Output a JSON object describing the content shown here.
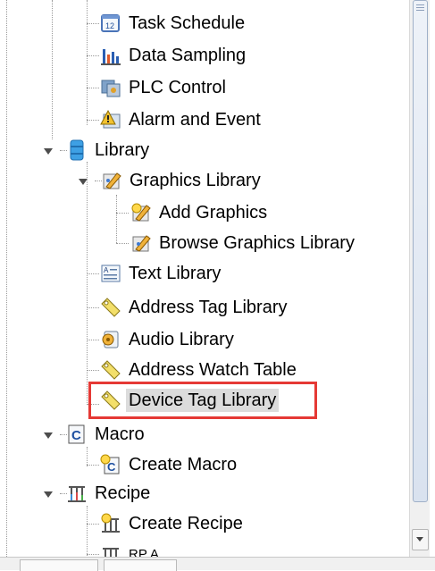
{
  "tree": {
    "items": [
      {
        "label": "Task Schedule",
        "icon": "task-schedule-icon"
      },
      {
        "label": "Data Sampling",
        "icon": "data-sampling-icon"
      },
      {
        "label": "PLC Control",
        "icon": "plc-control-icon"
      },
      {
        "label": "Alarm and Event",
        "icon": "alarm-event-icon"
      },
      {
        "label": "Library",
        "icon": "library-icon",
        "expanded": true
      },
      {
        "label": "Graphics Library",
        "icon": "graphics-library-icon",
        "expanded": true
      },
      {
        "label": "Add Graphics",
        "icon": "add-graphics-icon"
      },
      {
        "label": "Browse Graphics Library",
        "icon": "browse-graphics-icon"
      },
      {
        "label": "Text Library",
        "icon": "text-library-icon"
      },
      {
        "label": "Address Tag Library",
        "icon": "tag-icon"
      },
      {
        "label": "Audio Library",
        "icon": "audio-library-icon"
      },
      {
        "label": "Address Watch Table",
        "icon": "tag-icon"
      },
      {
        "label": "Device Tag Library",
        "icon": "tag-icon",
        "selected": true
      },
      {
        "label": "Macro",
        "icon": "macro-icon",
        "expanded": true
      },
      {
        "label": "Create Macro",
        "icon": "create-macro-icon"
      },
      {
        "label": "Recipe",
        "icon": "recipe-icon",
        "expanded": true
      },
      {
        "label": "Create Recipe",
        "icon": "create-recipe-icon"
      },
      {
        "label": "RP A",
        "icon": "recipe-item-icon"
      }
    ]
  },
  "colors": {
    "selection_outline": "#e53935",
    "selection_fill": "#dcdcdc"
  }
}
